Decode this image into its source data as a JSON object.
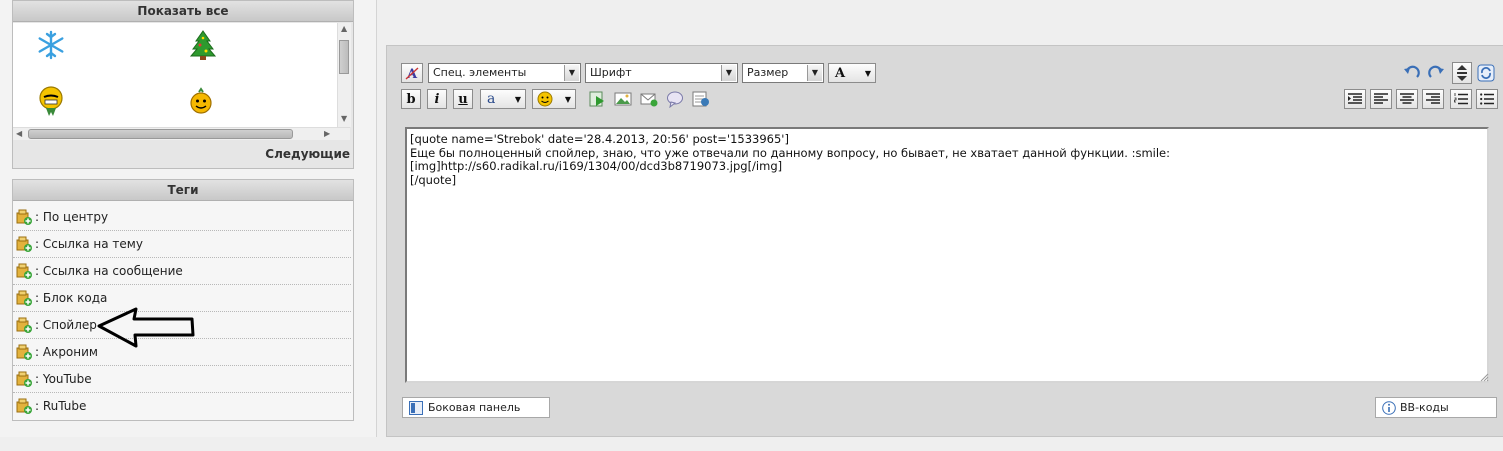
{
  "emoticons": {
    "header": "Показать все",
    "next_label": "Следующие",
    "icons": [
      "snowflake-icon",
      "christmas-tree-icon",
      "medal-smiley-icon",
      "pumpkin-smiley-icon"
    ]
  },
  "tags": {
    "header": "Теги",
    "items": [
      {
        "label": ": По центру"
      },
      {
        "label": ": Ссылка на тему"
      },
      {
        "label": ": Ссылка на сообщение"
      },
      {
        "label": ": Блок кода"
      },
      {
        "label": ": Спойлер"
      },
      {
        "label": ": Акроним"
      },
      {
        "label": ": YouTube"
      },
      {
        "label": ": RuTube"
      }
    ]
  },
  "toolbar": {
    "special_select": "Спец. элементы",
    "font_select": "Шрифт",
    "size_select": "Размер",
    "color_button": "A",
    "bold": "b",
    "italic": "i",
    "underline": "u",
    "font_color": "a"
  },
  "editor": {
    "content": "[quote name='Strebok' date='28.4.2013, 20:56' post='1533965']\nЕще бы полноценный спойлер, знаю, что уже отвечали по данному вопросу, но бывает, не хватает данной функции. :smile:\n[img]http://s60.radikal.ru/i169/1304/00/dcd3b8719073.jpg[/img]\n[/quote]"
  },
  "bottom": {
    "sidebar_button": "Боковая панель",
    "bbcodes_button": "BB-коды"
  },
  "colors": {
    "panel_header": "#c8c8c8",
    "editor_bg": "#ffffff",
    "accent_blue": "#3a6fb7"
  }
}
